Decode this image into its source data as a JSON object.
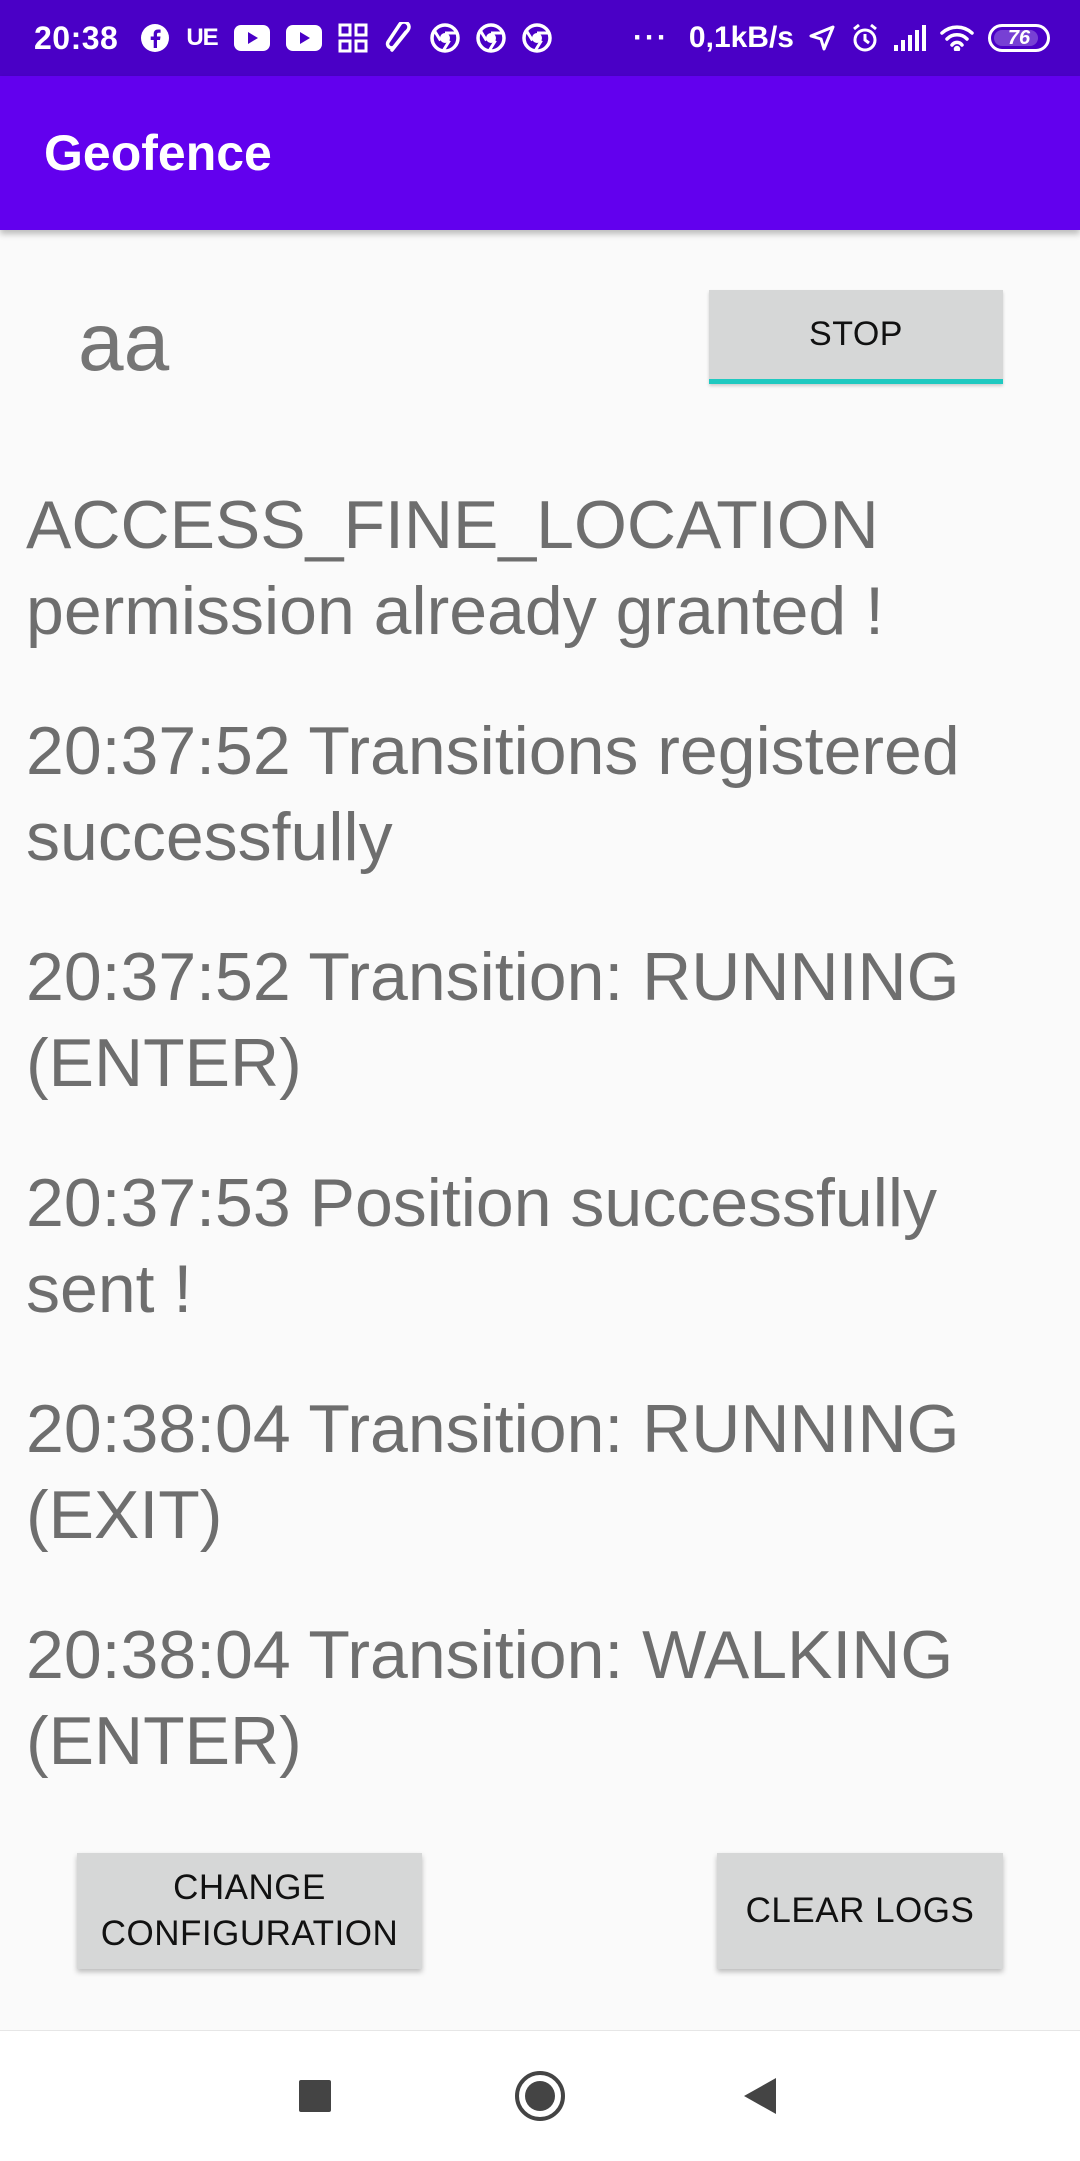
{
  "status_bar": {
    "time": "20:38",
    "carrier_badge": "UE",
    "speed": "0,1kB/s",
    "battery": "76",
    "icons": [
      "facebook-icon",
      "youtube-icon",
      "youtube-icon",
      "apps-icon",
      "paperclip-icon",
      "chrome-icon",
      "chrome-icon",
      "chrome-icon",
      "more-dots-icon",
      "location-arrow-icon",
      "alarm-icon",
      "signal-icon",
      "wifi-icon",
      "battery-icon"
    ]
  },
  "app_bar": {
    "title": "Geofence"
  },
  "main": {
    "status_label": "aa",
    "stop_button": "STOP",
    "logs": [
      "ACCESS_FINE_LOCATION permission already granted !",
      "20:37:52 Transitions registered successfully",
      "20:37:52 Transition: RUNNING (ENTER)",
      "20:37:53 Position successfully sent !",
      "20:38:04 Transition: RUNNING (EXIT)",
      "20:38:04 Transition: WALKING (ENTER)"
    ]
  },
  "buttons": {
    "change_configuration_line1": "CHANGE",
    "change_configuration_line2": "CONFIGURATION",
    "clear_logs": "CLEAR LOGS"
  },
  "nav_bar": {
    "icons": [
      "recents-square-icon",
      "home-circle-icon",
      "back-triangle-icon"
    ]
  },
  "colors": {
    "status_bar": "#4a00c6",
    "app_bar": "#6200ee",
    "accent": "#1fc9c0",
    "button_bg": "#d6d7d7",
    "log_text": "#6e6e6e",
    "background": "#fafafa"
  }
}
